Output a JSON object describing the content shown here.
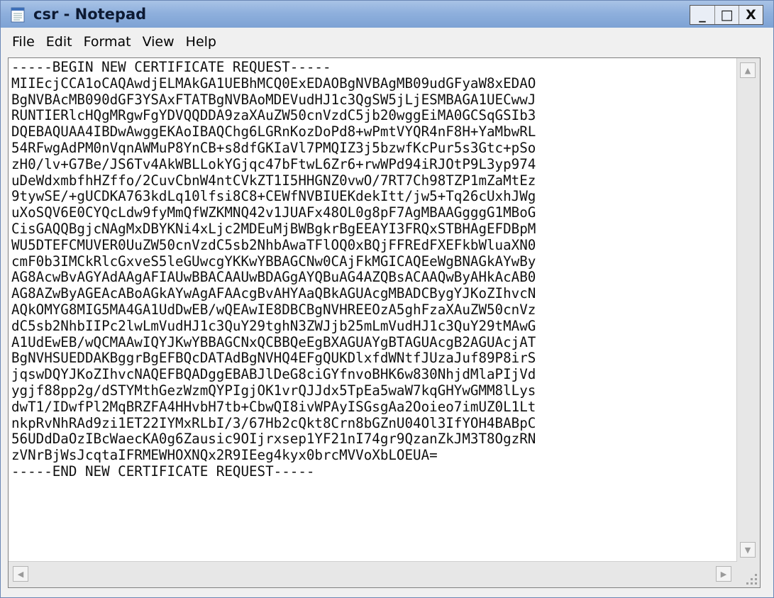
{
  "window": {
    "title": "csr - Notepad"
  },
  "controls": {
    "minimize": "_",
    "maximize": "□",
    "close": "X"
  },
  "menu": [
    "File",
    "Edit",
    "Format",
    "View",
    "Help"
  ],
  "content": "-----BEGIN NEW CERTIFICATE REQUEST-----\nMIIEcjCCA1oCAQAwdjELMAkGA1UEBhMCQ0ExEDAOBgNVBAgMB09udGFyaW8xEDAO\nBgNVBAcMB090dGF3YSAxFTATBgNVBAoMDEVudHJ1c3QgSW5jLjESMBAGA1UECwwJ\nRUNTIERlcHQgMRgwFgYDVQQDDA9zaXAuZW50cnVzdC5jb20wggEiMA0GCSqGSIb3\nDQEBAQUAA4IBDwAwggEKAoIBAQChg6LGRnKozDoPd8+wPmtVYQR4nF8H+YaMbwRL\n54RFwgAdPM0nVqnAWMuP8YnCB+s8dfGKIaVl7PMQIZ3j5bzwfKcPur5s3Gtc+pSo\nzH0/lv+G7Be/JS6Tv4AkWBLLokYGjqc47bFtwL6Zr6+rwWPd94iRJOtP9L3yp974\nuDeWdxmbfhHZffo/2CuvCbnW4ntCVkZT1I5HHGNZ0vwO/7RT7Ch98TZP1mZaMtEz\n9tywSE/+gUCDKA763kdLq10lfsi8C8+CEWfNVBIUEKdekItt/jw5+Tq26cUxhJWg\nuXoSQV6E0CYQcLdw9fyMmQfWZKMNQ42v1JUAFx48OL0g8pF7AgMBAAGgggG1MBoG\nCisGAQQBgjcNAgMxDBYKNi4xLjc2MDEuMjBWBgkrBgEEAYI3FRQxSTBHAgEFDBpM\nWU5DTEFCMUVER0UuZW50cnVzdC5sb2NhbAwaTFlOQ0xBQjFFREdFXEFkbWluaXN0\ncmF0b3IMCkRlcGxveS5leGUwcgYKKwYBBAGCNw0CAjFkMGICAQEeWgBNAGkAYwBy\nAG8AcwBvAGYAdAAgAFIAUwBBACAAUwBDAGgAYQBuAG4AZQBsACAAQwByAHkAcAB0\nAG8AZwByAGEAcABoAGkAYwAgAFAAcgBvAHYAaQBkAGUAcgMBADCBygYJKoZIhvcN\nAQkOMYG8MIG5MA4GA1UdDwEB/wQEAwIE8DBCBgNVHREEOzA5ghFzaXAuZW50cnVz\ndC5sb2NhbIIPc2lwLmVudHJ1c3QuY29tghN3ZWJjb25mLmVudHJ1c3QuY29tMAwG\nA1UdEwEB/wQCMAAwIQYJKwYBBAGCNxQCBBQeEgBXAGUAYgBTAGUAcgB2AGUAcjAT\nBgNVHSUEDDAKBggrBgEFBQcDATAdBgNVHQ4EFgQUKDlxfdWNtfJUzaJuf89P8irS\njqswDQYJKoZIhvcNAQEFBQADggEBABJlDeG8ciGYfnvoBHK6w830NhjdMlaPIjVd\nygjf88pp2g/dSTYMthGezWzmQYPIgjOK1vrQJJdx5TpEa5waW7kqGHYwGMM8lLys\ndwT1/IDwfPl2MqBRZFA4HHvbH7tb+CbwQI8ivWPAyISGsgAa2Ooieo7imUZ0L1Lt\nnkpRvNhRAd9zi1ET22IYMxRLbI/3/67Hb2cQkt8Crn8bGZnU04Ol3IfYOH4BABpC\n56UDdDaOzIBcWaecKA0g6Zausic9OIjrxsep1YF21nI74gr9QzanZkJM3T8OgzRN\nzVNrBjWsJcqtaIFRMEWHOXNQx2R9IEeg4kyx0brcMVVoXbLOEUA=\n-----END NEW CERTIFICATE REQUEST-----"
}
